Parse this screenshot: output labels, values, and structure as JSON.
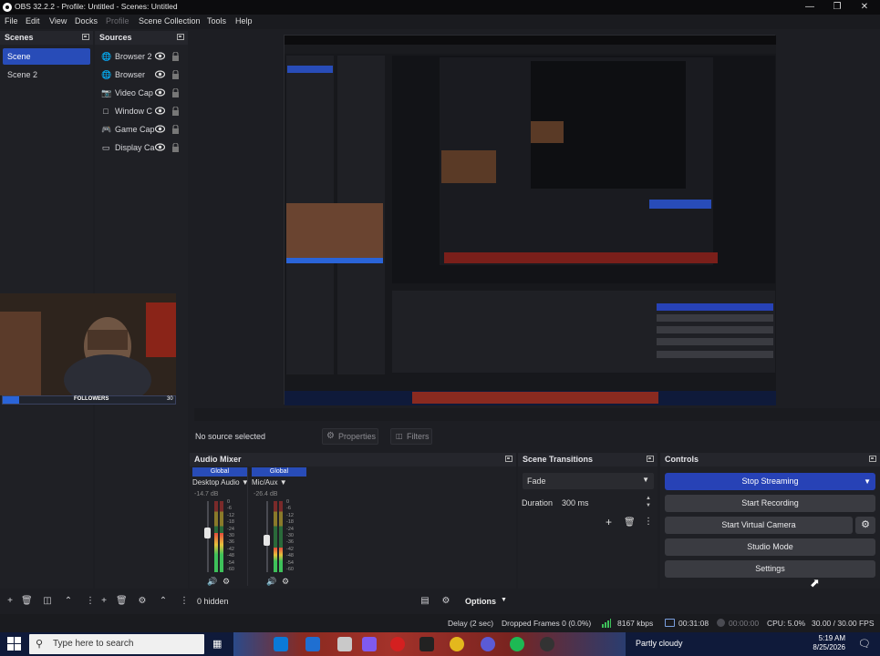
{
  "window": {
    "title": "OBS 32.2.2 - Profile: Untitled - Scenes: Untitled"
  },
  "menu": [
    "File",
    "Edit",
    "View",
    "Docks",
    "Profile",
    "Scene Collection",
    "Tools",
    "Help"
  ],
  "scenes": {
    "title": "Scenes",
    "items": [
      "Scene",
      "Scene 2"
    ],
    "selected": 0
  },
  "sources": {
    "title": "Sources",
    "items": [
      {
        "name": "Browser 2",
        "icon": "globe-icon"
      },
      {
        "name": "Browser",
        "icon": "globe-icon"
      },
      {
        "name": "Video Cap",
        "icon": "camera-icon"
      },
      {
        "name": "Window C",
        "icon": "window-icon"
      },
      {
        "name": "Game Cap",
        "icon": "gamepad-icon"
      },
      {
        "name": "Display Ca",
        "icon": "monitor-icon"
      }
    ]
  },
  "overlay": {
    "followers_label": "FOLLOWERS",
    "followers_count": "30"
  },
  "preview_bar": {
    "no_source": "No source selected",
    "properties": "Properties",
    "filters": "Filters"
  },
  "audio_mixer": {
    "title": "Audio Mixer",
    "channels": [
      {
        "group": "Global",
        "name": "Desktop Audio",
        "db": "-14.7 dB",
        "level": 0.55,
        "fader": 0.55
      },
      {
        "group": "Global",
        "name": "Mic/Aux",
        "db": "-26.4 dB",
        "level": 0.35,
        "fader": 0.45
      }
    ],
    "scale": [
      "0",
      "-6",
      "-12",
      "-18",
      "-24",
      "-30",
      "-36",
      "-42",
      "-48",
      "-54",
      "-60"
    ],
    "hidden_label": "0 hidden",
    "options_label": "Options"
  },
  "transitions": {
    "title": "Scene Transitions",
    "type": "Fade",
    "duration_label": "Duration",
    "duration_value": "300 ms"
  },
  "controls": {
    "title": "Controls",
    "stop_streaming": "Stop Streaming",
    "start_recording": "Start Recording",
    "start_virtual_camera": "Start Virtual Camera",
    "studio_mode": "Studio Mode",
    "settings": "Settings"
  },
  "status": {
    "delay": "Delay (2 sec)",
    "dropped": "Dropped Frames 0 (0.0%)",
    "bitrate": "8167 kbps",
    "stream_time": "00:31:08",
    "record_time": "00:00:00",
    "cpu": "CPU: 5.0%",
    "fps": "30.00 / 30.00 FPS"
  },
  "taskbar": {
    "search_placeholder": "Type here to search",
    "weather": "Partly cloudy",
    "time": "5:19 AM",
    "date": "8/25/2026"
  },
  "colors": {
    "accent": "#284cb8",
    "primary_button": "#2742b6",
    "panel": "#1f2025",
    "background": "#1d1e23"
  }
}
